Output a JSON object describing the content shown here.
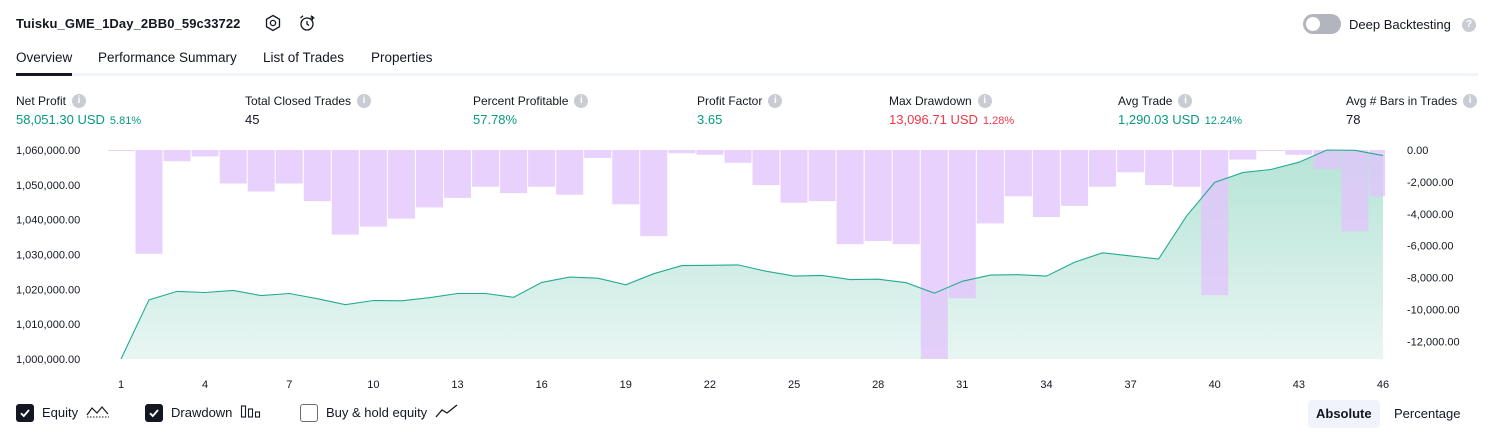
{
  "header": {
    "title": "Tuisku_GME_1Day_2BB0_59c33722",
    "deep_backtesting_label": "Deep Backtesting",
    "deep_backtesting_enabled": false
  },
  "tabs": [
    {
      "label": "Overview",
      "active": true
    },
    {
      "label": "Performance Summary",
      "active": false
    },
    {
      "label": "List of Trades",
      "active": false
    },
    {
      "label": "Properties",
      "active": false
    }
  ],
  "metrics": [
    {
      "label": "Net Profit",
      "value": "58,051.30 USD",
      "pct": "5.81%",
      "tone": "pos"
    },
    {
      "label": "Total Closed Trades",
      "value": "45",
      "pct": "",
      "tone": "plain"
    },
    {
      "label": "Percent Profitable",
      "value": "57.78%",
      "pct": "",
      "tone": "pos"
    },
    {
      "label": "Profit Factor",
      "value": "3.65",
      "pct": "",
      "tone": "pos"
    },
    {
      "label": "Max Drawdown",
      "value": "13,096.71 USD",
      "pct": "1.28%",
      "tone": "neg"
    },
    {
      "label": "Avg Trade",
      "value": "1,290.03 USD",
      "pct": "12.24%",
      "tone": "pos"
    },
    {
      "label": "Avg # Bars in Trades",
      "value": "78",
      "pct": "",
      "tone": "plain"
    }
  ],
  "colors": {
    "equity_line": "#22ab94",
    "equity_fill": "#bfe6dc",
    "drawdown_bar": "#e1c4fb",
    "positive": "#089981",
    "negative": "#f23645"
  },
  "chart_data": {
    "type": "bar+area",
    "x_ticks": [
      "1",
      "4",
      "7",
      "10",
      "13",
      "16",
      "19",
      "22",
      "25",
      "28",
      "31",
      "34",
      "37",
      "40",
      "43",
      "46"
    ],
    "y_left_ticks": [
      "1,060,000.00",
      "1,050,000.00",
      "1,040,000.00",
      "1,030,000.00",
      "1,020,000.00",
      "1,010,000.00",
      "1,000,000.00"
    ],
    "y_right_ticks": [
      "0.00",
      "-2,000.00",
      "-4,000.00",
      "-6,000.00",
      "-8,000.00",
      "-10,000.00",
      "-12,000.00"
    ],
    "y_left_range": [
      1000000,
      1060000
    ],
    "y_right_range": [
      -13096.71,
      0
    ],
    "x_range": [
      1,
      46
    ],
    "series": [
      {
        "name": "Equity",
        "type": "area",
        "axis": "left",
        "x": [
          1,
          2,
          3,
          4,
          5,
          6,
          7,
          8,
          9,
          10,
          11,
          12,
          13,
          14,
          15,
          16,
          17,
          18,
          19,
          20,
          21,
          22,
          23,
          24,
          25,
          26,
          27,
          28,
          29,
          30,
          31,
          32,
          33,
          34,
          35,
          36,
          37,
          38,
          39,
          40,
          41,
          42,
          43,
          44,
          45,
          46
        ],
        "values": [
          1000000,
          1017000,
          1019400,
          1019100,
          1019700,
          1018200,
          1018800,
          1017300,
          1015600,
          1016800,
          1016700,
          1017600,
          1018800,
          1018800,
          1017700,
          1022000,
          1023500,
          1023200,
          1021300,
          1024500,
          1026800,
          1026900,
          1027000,
          1025200,
          1023800,
          1024000,
          1022800,
          1022900,
          1021900,
          1018900,
          1022300,
          1024100,
          1024200,
          1023800,
          1027800,
          1030500,
          1029600,
          1028700,
          1041100,
          1050700,
          1053500,
          1054400,
          1056500,
          1060000,
          1059900,
          1058400
        ]
      },
      {
        "name": "Drawdown",
        "type": "bar",
        "axis": "right",
        "x": [
          1,
          2,
          3,
          4,
          5,
          6,
          7,
          8,
          9,
          10,
          11,
          12,
          13,
          14,
          15,
          16,
          17,
          18,
          19,
          20,
          21,
          22,
          23,
          24,
          25,
          26,
          27,
          28,
          29,
          30,
          31,
          32,
          33,
          34,
          35,
          36,
          37,
          38,
          39,
          40,
          41,
          42,
          43,
          44,
          45,
          46
        ],
        "values": [
          -50,
          -6500,
          -700,
          -400,
          -2100,
          -2600,
          -2100,
          -3200,
          -5300,
          -4800,
          -4300,
          -3600,
          -3000,
          -2300,
          -2700,
          -2300,
          -2800,
          -500,
          -3400,
          -5400,
          -200,
          -300,
          -800,
          -2200,
          -3300,
          -3200,
          -5900,
          -5700,
          -5900,
          -13096.71,
          -9300,
          -4600,
          -2900,
          -4200,
          -3500,
          -2300,
          -1400,
          -2200,
          -2300,
          -9100,
          -600,
          -50,
          -300,
          -1200,
          -5100,
          -2900
        ]
      }
    ]
  },
  "legend": [
    {
      "label": "Equity",
      "checked": true,
      "icon": "equity-area-icon"
    },
    {
      "label": "Drawdown",
      "checked": true,
      "icon": "drawdown-bars-icon"
    },
    {
      "label": "Buy & hold equity",
      "checked": false,
      "icon": "buy-hold-line-icon"
    }
  ],
  "scale_toggle": {
    "absolute": "Absolute",
    "percentage": "Percentage",
    "selected": "Absolute"
  }
}
